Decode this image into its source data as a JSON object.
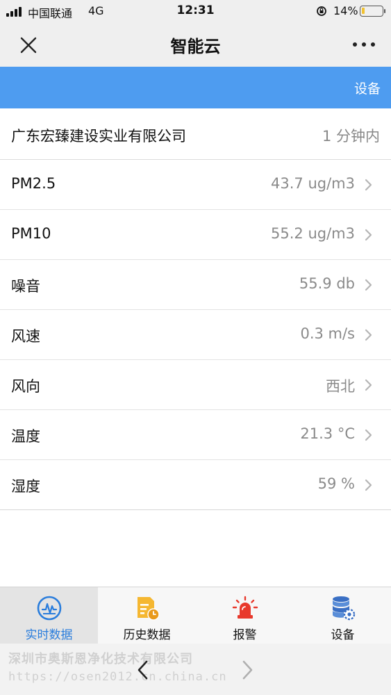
{
  "status_bar": {
    "carrier": "中国联通",
    "network": "4G",
    "time": "12:31",
    "battery_percent_text": "14%",
    "battery_level": 0.14,
    "battery_color": "#f1c232"
  },
  "nav": {
    "title": "智能云",
    "close_icon": "close-icon",
    "more_icon": "more-icon"
  },
  "header": {
    "device_link": "设备",
    "color": "#4e9cf0"
  },
  "company": {
    "name": "广东宏臻建设实业有限公司",
    "updated": "1 分钟内"
  },
  "readings": [
    {
      "label": "PM2.5",
      "value": "43.7 ug/m3"
    },
    {
      "label": "PM10",
      "value": "55.2 ug/m3"
    },
    {
      "label": "噪音",
      "value": "55.9 db"
    },
    {
      "label": "风速",
      "value": "0.3 m/s"
    },
    {
      "label": "风向",
      "value": "西北"
    },
    {
      "label": "温度",
      "value": "21.3 °C"
    },
    {
      "label": "湿度",
      "value": "59 %"
    }
  ],
  "tabs": [
    {
      "label": "实时数据",
      "icon": "realtime-chart-icon",
      "active": true
    },
    {
      "label": "历史数据",
      "icon": "history-document-icon",
      "active": false
    },
    {
      "label": "报警",
      "icon": "alarm-siren-icon",
      "active": false
    },
    {
      "label": "设备",
      "icon": "device-database-gear-icon",
      "active": false
    }
  ],
  "watermark": {
    "company": "深圳市奥斯恩净化技术有限公司",
    "url": "https://osen2012.cn.china.cn"
  },
  "colors": {
    "accent": "#2a7ddc",
    "history_icon": "#f5b731",
    "alarm_icon": "#e8392c",
    "device_icon": "#3a6fc4"
  }
}
